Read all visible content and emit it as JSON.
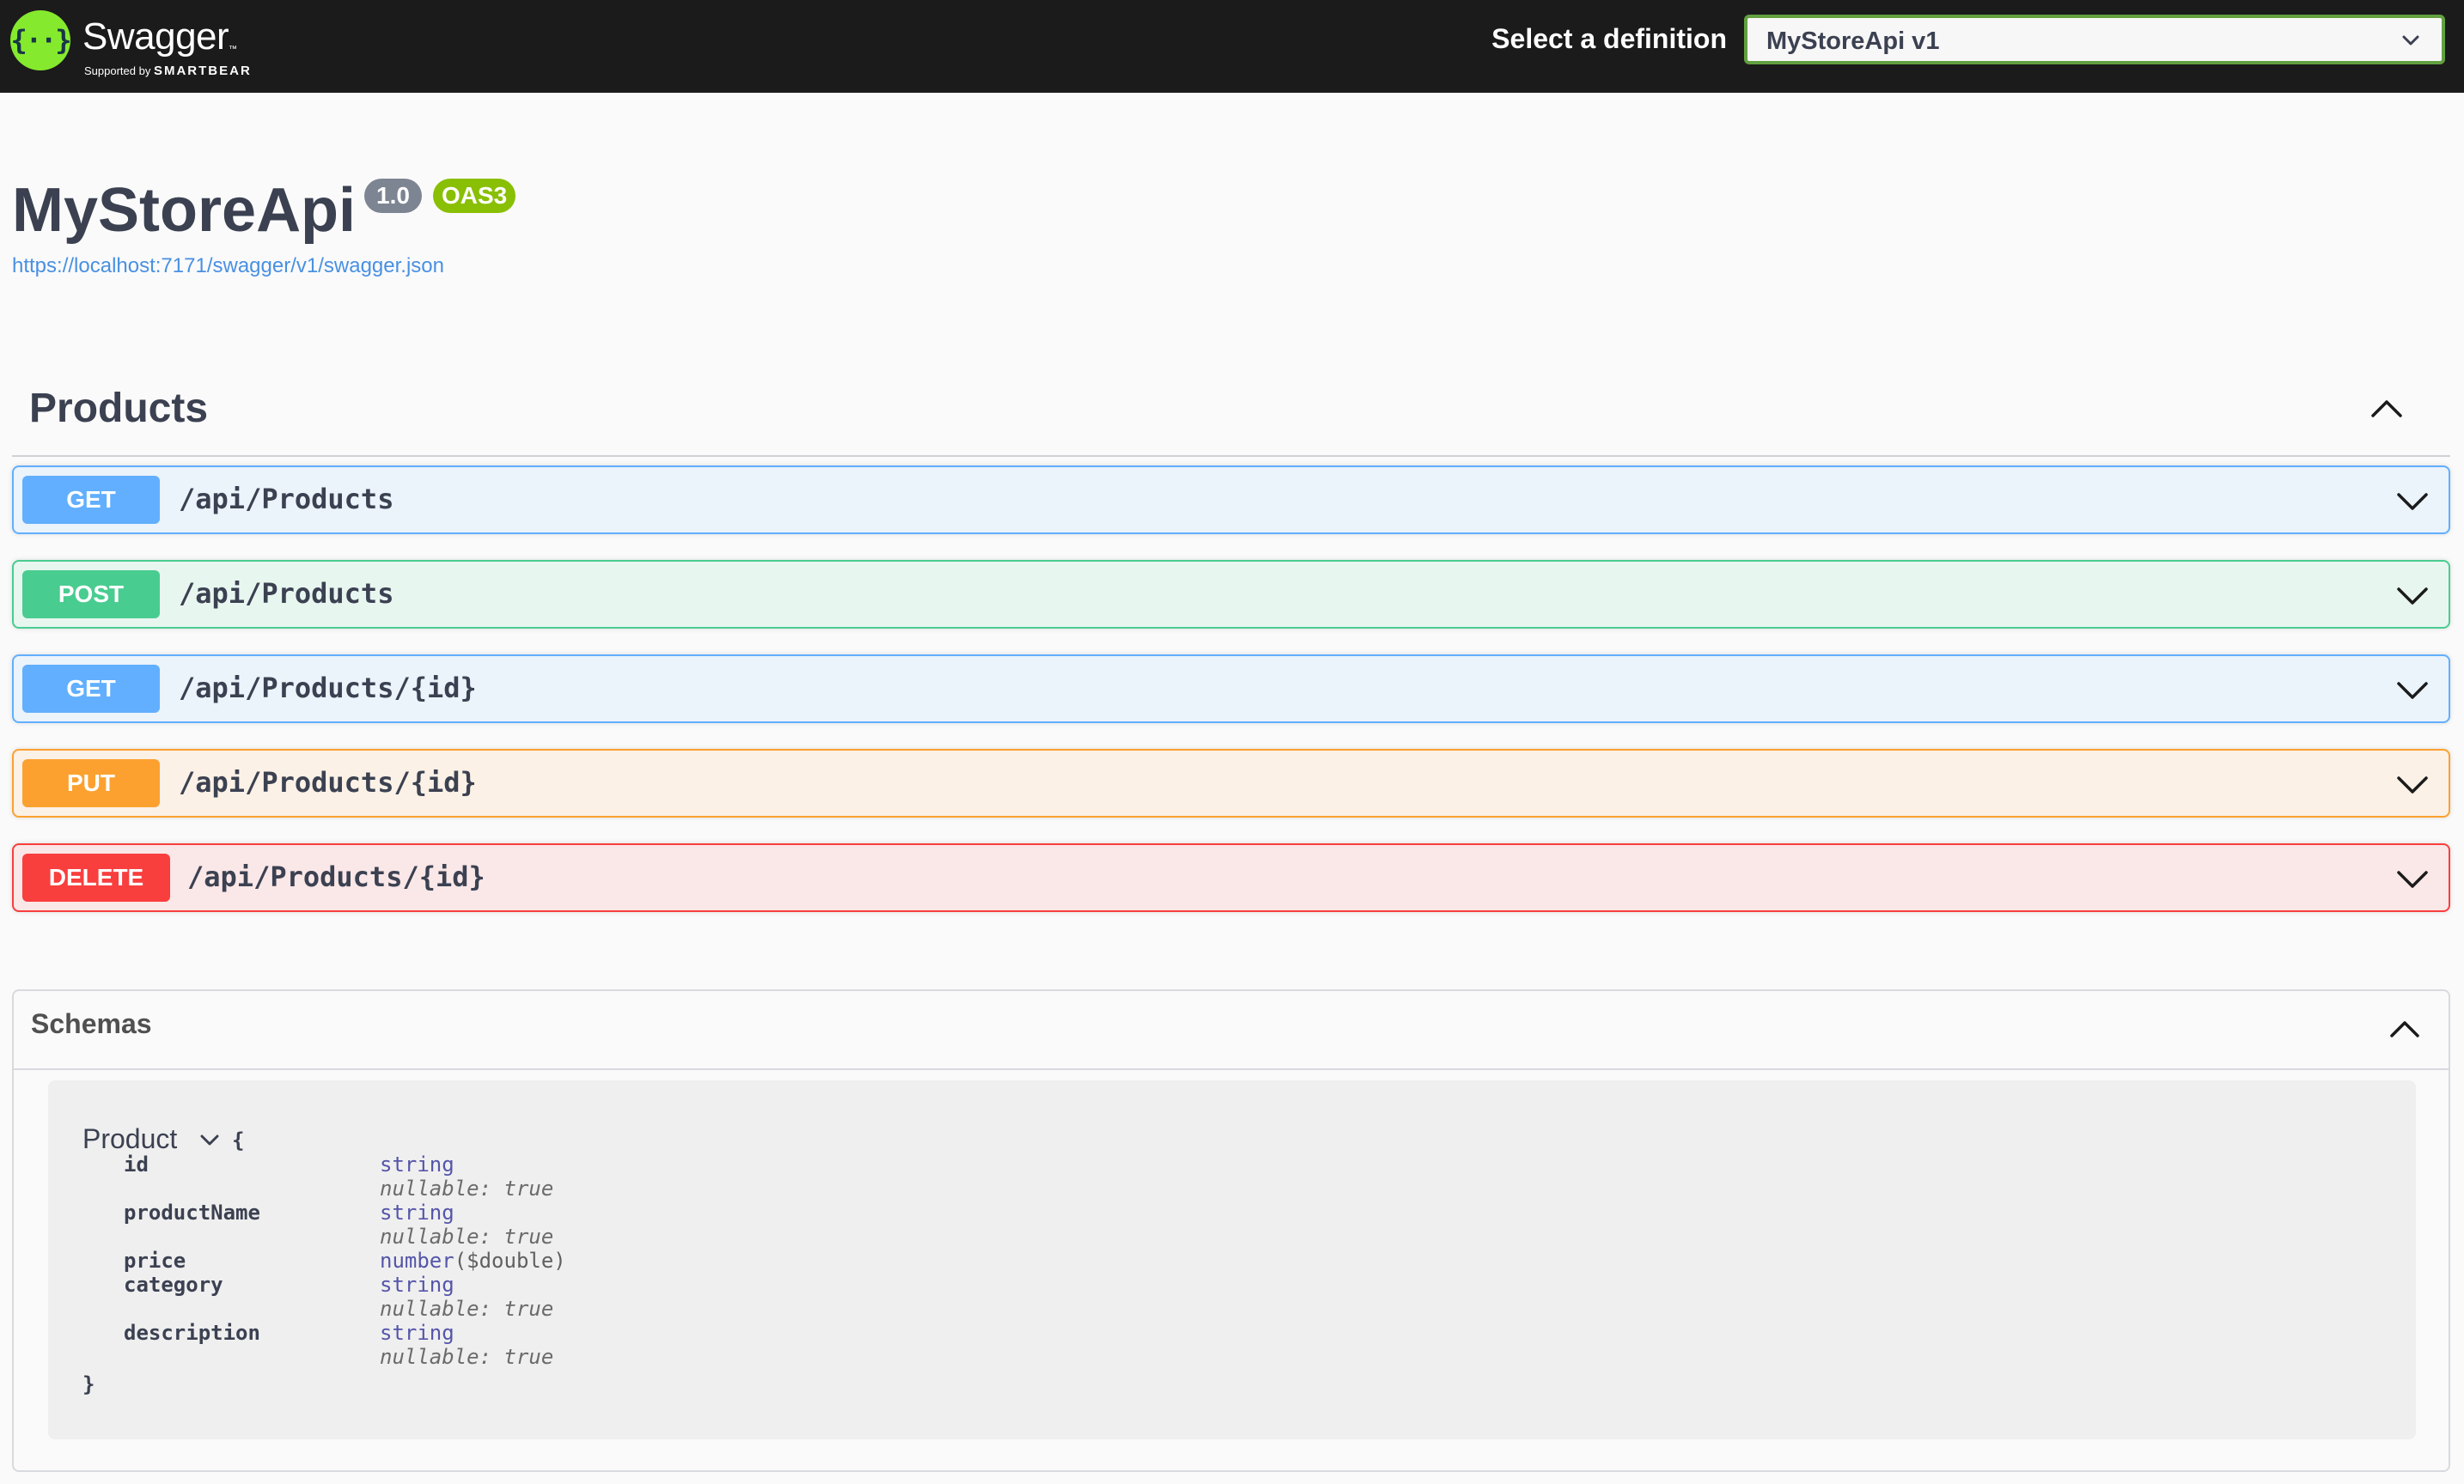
{
  "topbar": {
    "logo_name": "Swagger",
    "logo_tm": "™",
    "logo_supported_by": "Supported by",
    "logo_company": "SMARTBEAR",
    "definition_label": "Select a definition",
    "definition_selected": "MyStoreApi v1"
  },
  "info": {
    "title": "MyStoreApi",
    "version": "1.0",
    "oas_badge": "OAS3",
    "spec_url": "https://localhost:7171/swagger/v1/swagger.json"
  },
  "tag": {
    "name": "Products"
  },
  "operations": [
    {
      "method": "GET",
      "path": "/api/Products"
    },
    {
      "method": "POST",
      "path": "/api/Products"
    },
    {
      "method": "GET",
      "path": "/api/Products/{id}"
    },
    {
      "method": "PUT",
      "path": "/api/Products/{id}"
    },
    {
      "method": "DELETE",
      "path": "/api/Products/{id}"
    }
  ],
  "schemas": {
    "title": "Schemas",
    "model": {
      "name": "Product",
      "open_brace": "{",
      "close_brace": "}",
      "properties": [
        {
          "name": "id",
          "type": "string",
          "nullable": "nullable: true"
        },
        {
          "name": "productName",
          "type": "string",
          "nullable": "nullable: true"
        },
        {
          "name": "price",
          "type": "number",
          "format": "($double)"
        },
        {
          "name": "category",
          "type": "string",
          "nullable": "nullable: true"
        },
        {
          "name": "description",
          "type": "string",
          "nullable": "nullable: true"
        }
      ]
    }
  },
  "colors": {
    "get": "#61affe",
    "post": "#49cc90",
    "put": "#fca130",
    "delete": "#f93e3e",
    "topbar": "#1b1b1b",
    "logo_green": "#85ea2d",
    "select_border": "#62a03f",
    "link": "#4990e2"
  },
  "icons": {
    "logo": "swagger-logo-icon",
    "select": "chevron-down-icon",
    "tag_collapse": "chevron-up-icon",
    "operation_expand": "chevron-down-icon",
    "model_toggle": "chevron-down-icon"
  }
}
